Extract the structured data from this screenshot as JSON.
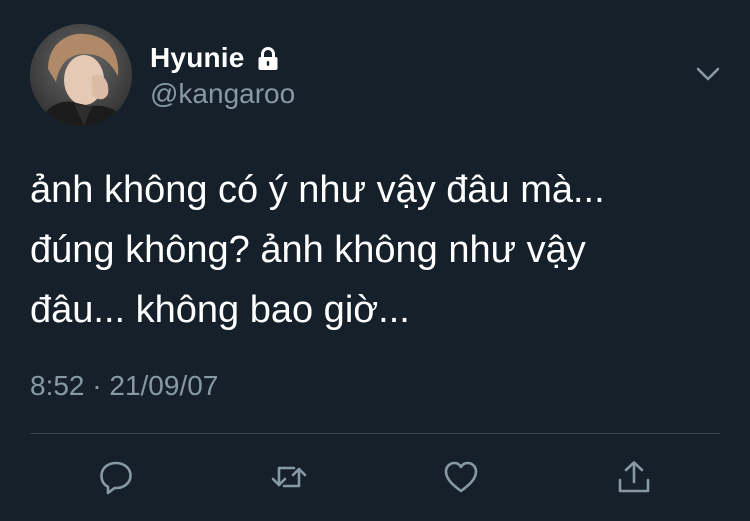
{
  "user": {
    "display_name": "Hyunie",
    "handle": "@kangaroo",
    "protected_icon": "lock-icon",
    "avatar": "avatar-photo"
  },
  "tweet": {
    "lines": [
      "ảnh không có ý như vậy đâu mà...",
      "đúng không? ảnh không như vậy",
      "đâu... không bao giờ..."
    ],
    "timestamp": "8:52 · 21/09/07"
  },
  "menu": {
    "icon": "chevron-down-icon"
  },
  "actions": [
    {
      "icon": "reply-icon"
    },
    {
      "icon": "retweet-icon"
    },
    {
      "icon": "like-icon"
    },
    {
      "icon": "share-icon"
    }
  ],
  "colors": {
    "background": "#15202b",
    "text_primary": "#ffffff",
    "text_secondary": "#8899a6",
    "divider": "#38444d"
  }
}
